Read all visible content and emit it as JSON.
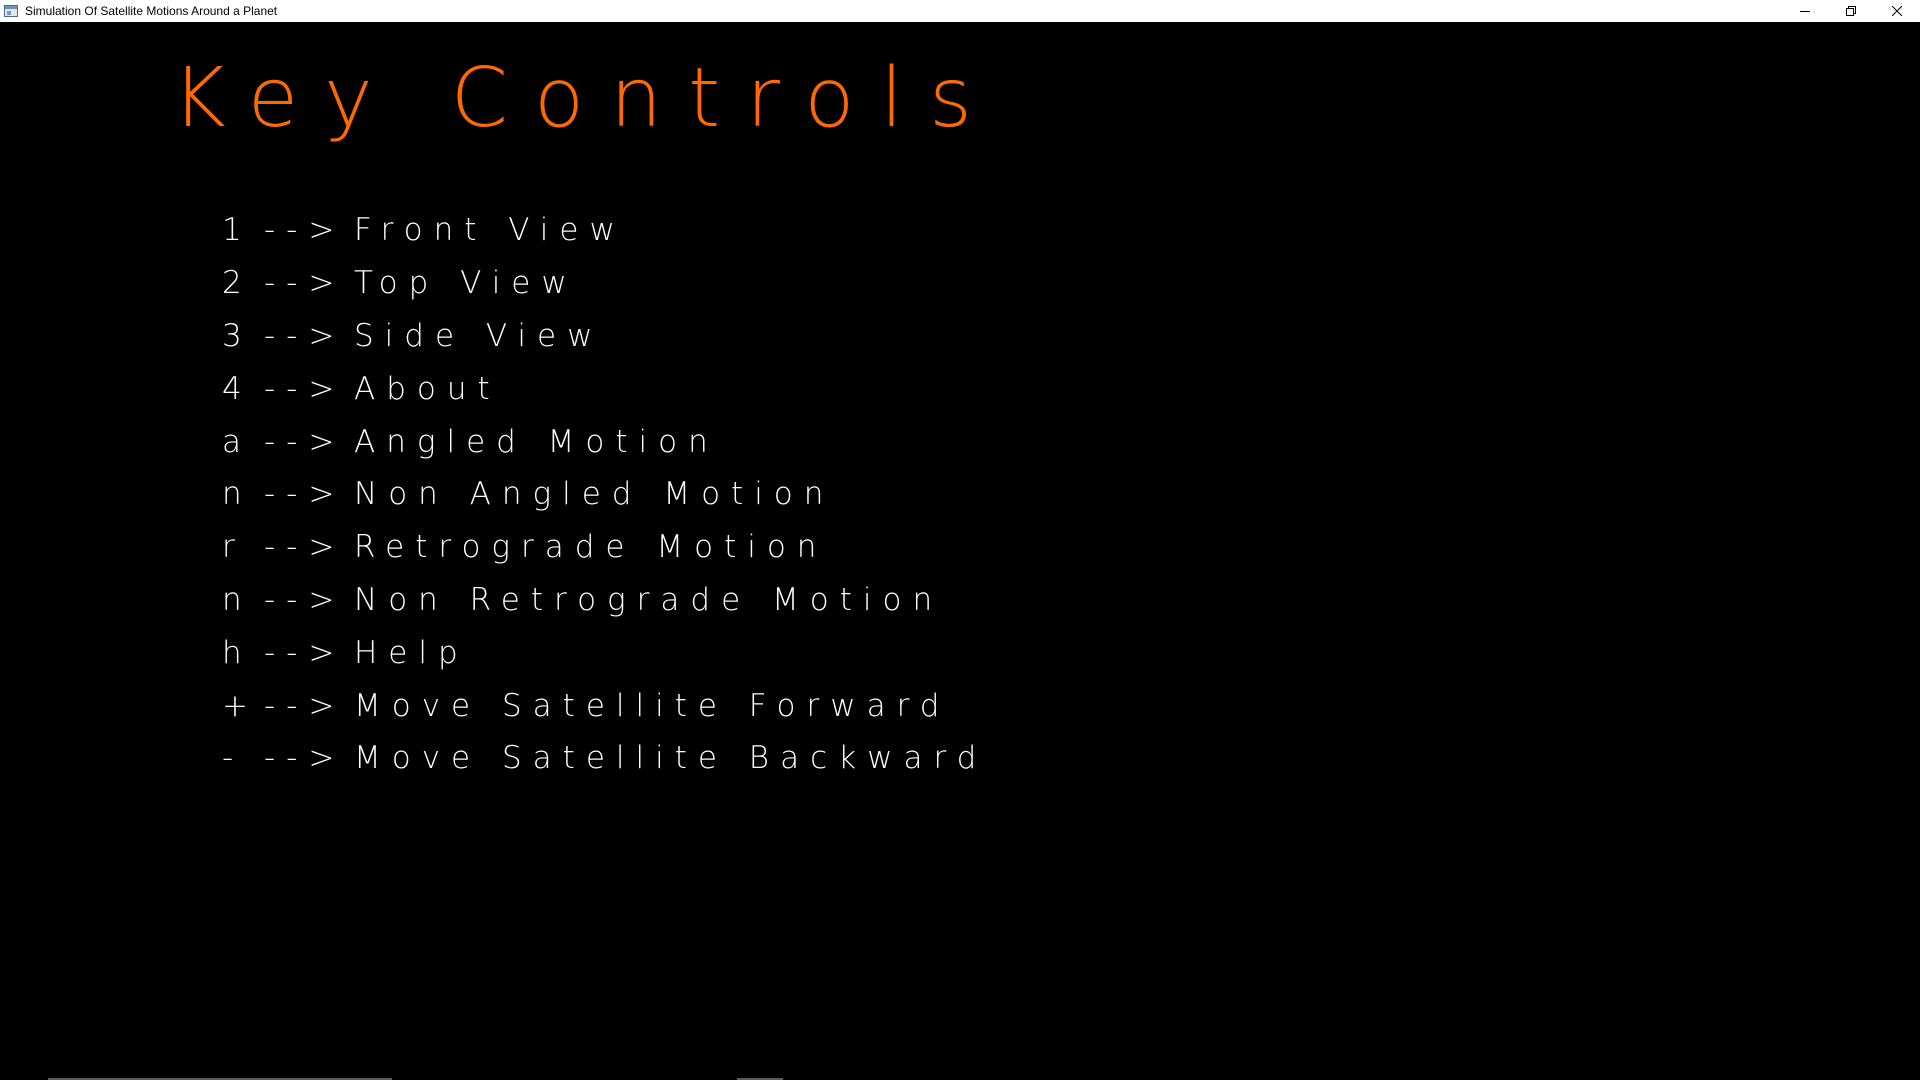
{
  "window": {
    "title": "Simulation Of Satellite Motions Around a Planet",
    "controls": {
      "minimize_icon": "minimize-icon",
      "restore_icon": "restore-icon",
      "close_icon": "close-icon"
    }
  },
  "canvas": {
    "heading": "Key Controls",
    "heading_color": "#ff6a00",
    "text_color": "#ffffff",
    "background": "#000000",
    "arrow": "-->",
    "controls": [
      {
        "key": "1",
        "action": "Front View"
      },
      {
        "key": "2",
        "action": "Top View"
      },
      {
        "key": "3",
        "action": "Side View"
      },
      {
        "key": "4",
        "action": "About"
      },
      {
        "key": "a",
        "action": "Angled Motion"
      },
      {
        "key": "n",
        "action": "Non Angled Motion"
      },
      {
        "key": "r",
        "action": "Retrograde Motion"
      },
      {
        "key": "n",
        "action": "Non Retrograde Motion"
      },
      {
        "key": "h",
        "action": "Help"
      },
      {
        "key": "+",
        "action": "Move Satellite Forward"
      },
      {
        "key": "-",
        "action": "Move Satellite Backward"
      }
    ]
  }
}
